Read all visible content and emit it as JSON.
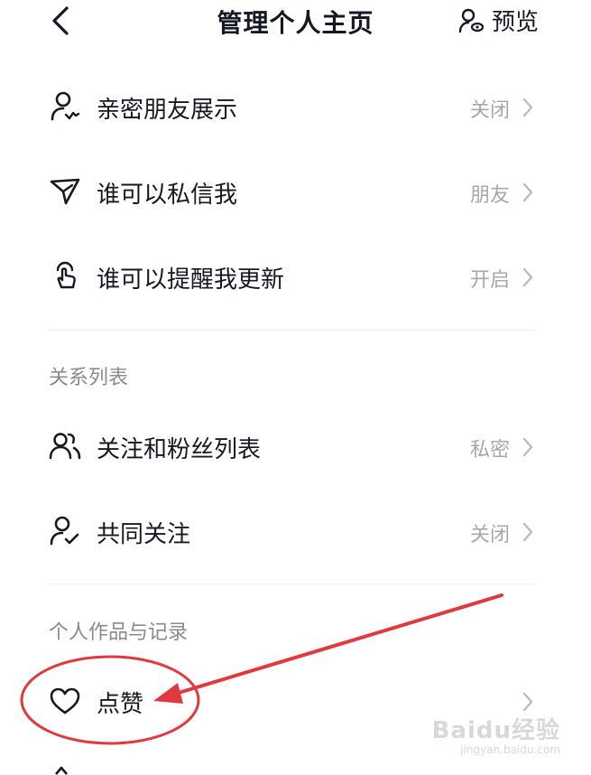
{
  "header": {
    "title": "管理个人主页",
    "preview_label": "预览"
  },
  "rows_top": [
    {
      "label": "亲密朋友展示",
      "value": "关闭",
      "icon": "user-heart-icon"
    },
    {
      "label": "谁可以私信我",
      "value": "朋友",
      "icon": "send-icon"
    },
    {
      "label": "谁可以提醒我更新",
      "value": "开启",
      "icon": "tap-hand-icon"
    }
  ],
  "section_relations": {
    "title": "关系列表",
    "rows": [
      {
        "label": "关注和粉丝列表",
        "value": "私密",
        "icon": "users-icon"
      },
      {
        "label": "共同关注",
        "value": "关闭",
        "icon": "user-check-icon"
      }
    ]
  },
  "section_works": {
    "title": "个人作品与记录",
    "rows": [
      {
        "label": "点赞",
        "value": "",
        "icon": "heart-icon"
      }
    ]
  },
  "watermark": {
    "brand": "Baidu经验",
    "url": "jingyan.baidu.com"
  },
  "colors": {
    "text": "#161823",
    "secondary": "#a7a8ac",
    "annotation": "#e0393e"
  }
}
